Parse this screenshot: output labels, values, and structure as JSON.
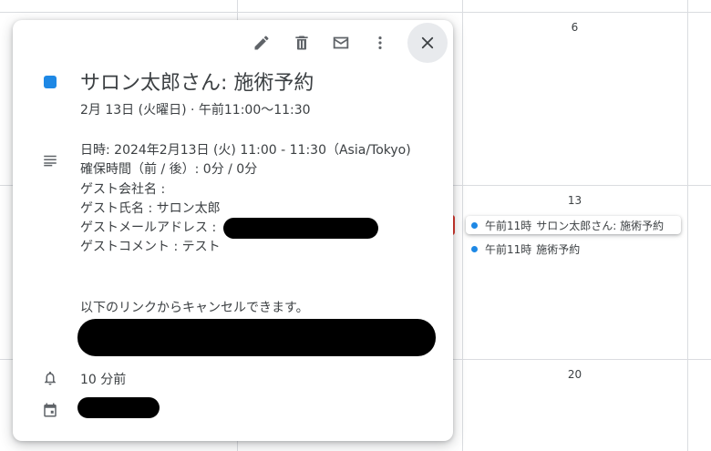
{
  "calendar": {
    "day_numbers": [
      "6",
      "13",
      "20"
    ],
    "events": [
      {
        "time": "午前11時",
        "title": "サロン太郎さん: 施術予約",
        "selected": true
      },
      {
        "time": "午前11時",
        "title": "施術予約",
        "selected": false
      }
    ],
    "event_color": "#1e88e5",
    "marker_color": "#d93025"
  },
  "popup": {
    "toolbar": {
      "edit_icon": "pencil-icon",
      "delete_icon": "trash-icon",
      "email_icon": "envelope-icon",
      "more_icon": "more-vert-icon",
      "close_icon": "close-icon"
    },
    "color": "#1e88e5",
    "title": "サロン太郎さん: 施術予約",
    "when": "2月 13日 (火曜日)  ·  午前11:00～11:30",
    "description_lines": [
      "日時: 2024年2月13日 (火) 11:00 - 11:30（Asia/Tokyo)",
      "確保時間（前 / 後）: 0分 / 0分",
      "ゲスト会社名 :",
      "ゲスト氏名 : サロン太郎",
      "ゲストメールアドレス :",
      "ゲストコメント : テスト"
    ],
    "cancel_text": "以下のリンクからキャンセルできます。",
    "reminder": "10 分前"
  }
}
